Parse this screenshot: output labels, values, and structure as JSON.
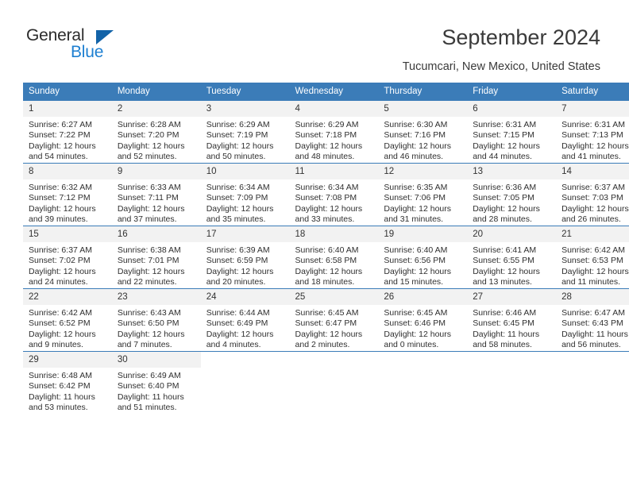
{
  "brand": {
    "name_top": "General",
    "name_bottom": "Blue",
    "accent_color": "#1263a8",
    "text_color": "#1d7fd1"
  },
  "header": {
    "title": "September 2024",
    "subtitle": "Tucumcari, New Mexico, United States"
  },
  "calendar": {
    "header_bg": "#3b7cb8",
    "daynum_bg": "#f2f2f2",
    "weekday_headers": [
      "Sunday",
      "Monday",
      "Tuesday",
      "Wednesday",
      "Thursday",
      "Friday",
      "Saturday"
    ],
    "labels": {
      "sunrise": "Sunrise:",
      "sunset": "Sunset:",
      "daylight": "Daylight:"
    },
    "weeks": [
      [
        {
          "day": "1",
          "sunrise": "Sunrise: 6:27 AM",
          "sunset": "Sunset: 7:22 PM",
          "daylight_1": "Daylight: 12 hours",
          "daylight_2": "and 54 minutes."
        },
        {
          "day": "2",
          "sunrise": "Sunrise: 6:28 AM",
          "sunset": "Sunset: 7:20 PM",
          "daylight_1": "Daylight: 12 hours",
          "daylight_2": "and 52 minutes."
        },
        {
          "day": "3",
          "sunrise": "Sunrise: 6:29 AM",
          "sunset": "Sunset: 7:19 PM",
          "daylight_1": "Daylight: 12 hours",
          "daylight_2": "and 50 minutes."
        },
        {
          "day": "4",
          "sunrise": "Sunrise: 6:29 AM",
          "sunset": "Sunset: 7:18 PM",
          "daylight_1": "Daylight: 12 hours",
          "daylight_2": "and 48 minutes."
        },
        {
          "day": "5",
          "sunrise": "Sunrise: 6:30 AM",
          "sunset": "Sunset: 7:16 PM",
          "daylight_1": "Daylight: 12 hours",
          "daylight_2": "and 46 minutes."
        },
        {
          "day": "6",
          "sunrise": "Sunrise: 6:31 AM",
          "sunset": "Sunset: 7:15 PM",
          "daylight_1": "Daylight: 12 hours",
          "daylight_2": "and 44 minutes."
        },
        {
          "day": "7",
          "sunrise": "Sunrise: 6:31 AM",
          "sunset": "Sunset: 7:13 PM",
          "daylight_1": "Daylight: 12 hours",
          "daylight_2": "and 41 minutes."
        }
      ],
      [
        {
          "day": "8",
          "sunrise": "Sunrise: 6:32 AM",
          "sunset": "Sunset: 7:12 PM",
          "daylight_1": "Daylight: 12 hours",
          "daylight_2": "and 39 minutes."
        },
        {
          "day": "9",
          "sunrise": "Sunrise: 6:33 AM",
          "sunset": "Sunset: 7:11 PM",
          "daylight_1": "Daylight: 12 hours",
          "daylight_2": "and 37 minutes."
        },
        {
          "day": "10",
          "sunrise": "Sunrise: 6:34 AM",
          "sunset": "Sunset: 7:09 PM",
          "daylight_1": "Daylight: 12 hours",
          "daylight_2": "and 35 minutes."
        },
        {
          "day": "11",
          "sunrise": "Sunrise: 6:34 AM",
          "sunset": "Sunset: 7:08 PM",
          "daylight_1": "Daylight: 12 hours",
          "daylight_2": "and 33 minutes."
        },
        {
          "day": "12",
          "sunrise": "Sunrise: 6:35 AM",
          "sunset": "Sunset: 7:06 PM",
          "daylight_1": "Daylight: 12 hours",
          "daylight_2": "and 31 minutes."
        },
        {
          "day": "13",
          "sunrise": "Sunrise: 6:36 AM",
          "sunset": "Sunset: 7:05 PM",
          "daylight_1": "Daylight: 12 hours",
          "daylight_2": "and 28 minutes."
        },
        {
          "day": "14",
          "sunrise": "Sunrise: 6:37 AM",
          "sunset": "Sunset: 7:03 PM",
          "daylight_1": "Daylight: 12 hours",
          "daylight_2": "and 26 minutes."
        }
      ],
      [
        {
          "day": "15",
          "sunrise": "Sunrise: 6:37 AM",
          "sunset": "Sunset: 7:02 PM",
          "daylight_1": "Daylight: 12 hours",
          "daylight_2": "and 24 minutes."
        },
        {
          "day": "16",
          "sunrise": "Sunrise: 6:38 AM",
          "sunset": "Sunset: 7:01 PM",
          "daylight_1": "Daylight: 12 hours",
          "daylight_2": "and 22 minutes."
        },
        {
          "day": "17",
          "sunrise": "Sunrise: 6:39 AM",
          "sunset": "Sunset: 6:59 PM",
          "daylight_1": "Daylight: 12 hours",
          "daylight_2": "and 20 minutes."
        },
        {
          "day": "18",
          "sunrise": "Sunrise: 6:40 AM",
          "sunset": "Sunset: 6:58 PM",
          "daylight_1": "Daylight: 12 hours",
          "daylight_2": "and 18 minutes."
        },
        {
          "day": "19",
          "sunrise": "Sunrise: 6:40 AM",
          "sunset": "Sunset: 6:56 PM",
          "daylight_1": "Daylight: 12 hours",
          "daylight_2": "and 15 minutes."
        },
        {
          "day": "20",
          "sunrise": "Sunrise: 6:41 AM",
          "sunset": "Sunset: 6:55 PM",
          "daylight_1": "Daylight: 12 hours",
          "daylight_2": "and 13 minutes."
        },
        {
          "day": "21",
          "sunrise": "Sunrise: 6:42 AM",
          "sunset": "Sunset: 6:53 PM",
          "daylight_1": "Daylight: 12 hours",
          "daylight_2": "and 11 minutes."
        }
      ],
      [
        {
          "day": "22",
          "sunrise": "Sunrise: 6:42 AM",
          "sunset": "Sunset: 6:52 PM",
          "daylight_1": "Daylight: 12 hours",
          "daylight_2": "and 9 minutes."
        },
        {
          "day": "23",
          "sunrise": "Sunrise: 6:43 AM",
          "sunset": "Sunset: 6:50 PM",
          "daylight_1": "Daylight: 12 hours",
          "daylight_2": "and 7 minutes."
        },
        {
          "day": "24",
          "sunrise": "Sunrise: 6:44 AM",
          "sunset": "Sunset: 6:49 PM",
          "daylight_1": "Daylight: 12 hours",
          "daylight_2": "and 4 minutes."
        },
        {
          "day": "25",
          "sunrise": "Sunrise: 6:45 AM",
          "sunset": "Sunset: 6:47 PM",
          "daylight_1": "Daylight: 12 hours",
          "daylight_2": "and 2 minutes."
        },
        {
          "day": "26",
          "sunrise": "Sunrise: 6:45 AM",
          "sunset": "Sunset: 6:46 PM",
          "daylight_1": "Daylight: 12 hours",
          "daylight_2": "and 0 minutes."
        },
        {
          "day": "27",
          "sunrise": "Sunrise: 6:46 AM",
          "sunset": "Sunset: 6:45 PM",
          "daylight_1": "Daylight: 11 hours",
          "daylight_2": "and 58 minutes."
        },
        {
          "day": "28",
          "sunrise": "Sunrise: 6:47 AM",
          "sunset": "Sunset: 6:43 PM",
          "daylight_1": "Daylight: 11 hours",
          "daylight_2": "and 56 minutes."
        }
      ],
      [
        {
          "day": "29",
          "sunrise": "Sunrise: 6:48 AM",
          "sunset": "Sunset: 6:42 PM",
          "daylight_1": "Daylight: 11 hours",
          "daylight_2": "and 53 minutes."
        },
        {
          "day": "30",
          "sunrise": "Sunrise: 6:49 AM",
          "sunset": "Sunset: 6:40 PM",
          "daylight_1": "Daylight: 11 hours",
          "daylight_2": "and 51 minutes."
        },
        null,
        null,
        null,
        null,
        null
      ]
    ]
  }
}
